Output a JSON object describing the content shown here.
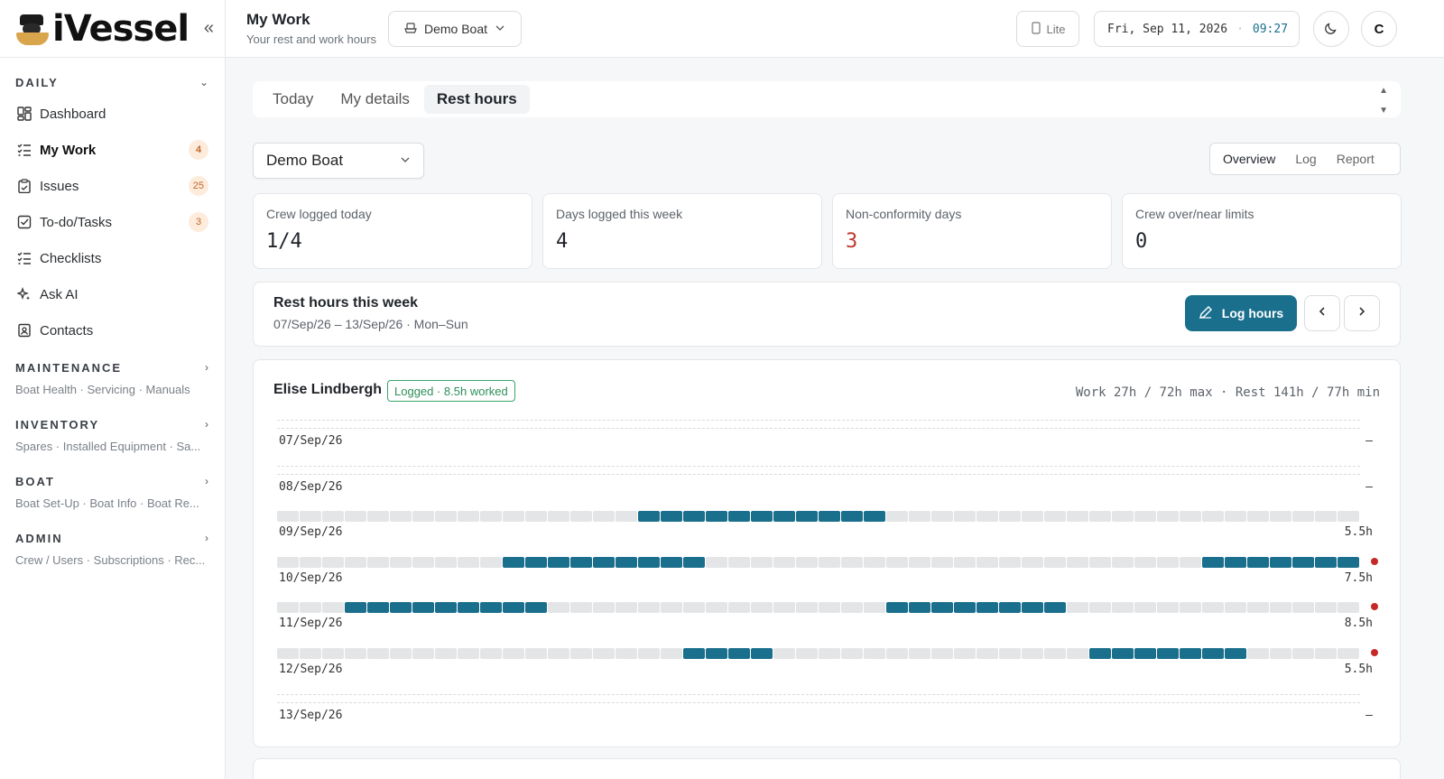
{
  "brand": {
    "name": "iVessel"
  },
  "sidebar": {
    "sections": [
      {
        "id": "daily",
        "title": "DAILY"
      },
      {
        "id": "maintenance",
        "title": "MAINTENANCE",
        "sub": "Boat Health · Servicing · Manuals"
      },
      {
        "id": "inventory",
        "title": "INVENTORY",
        "sub": "Spares · Installed Equipment · Sa..."
      },
      {
        "id": "boat",
        "title": "BOAT",
        "sub": "Boat Set-Up · Boat Info · Boat Re..."
      },
      {
        "id": "admin",
        "title": "ADMIN",
        "sub": "Crew / Users · Subscriptions · Rec..."
      }
    ],
    "items": [
      {
        "label": "Dashboard",
        "icon": "dashboard-icon"
      },
      {
        "label": "My Work",
        "icon": "list-check-icon",
        "badge": "4",
        "active": true
      },
      {
        "label": "Issues",
        "icon": "clipboard-icon",
        "badge": "25"
      },
      {
        "label": "To-do/Tasks",
        "icon": "checkbox-icon",
        "badge": "3"
      },
      {
        "label": "Checklists",
        "icon": "checklist-icon"
      },
      {
        "label": "Ask AI",
        "icon": "sparkle-icon"
      },
      {
        "label": "Contacts",
        "icon": "contacts-icon"
      }
    ]
  },
  "header": {
    "title": "My Work",
    "subtitle": "Your rest and work hours",
    "boat_selector": "Demo Boat",
    "lite_label": "Lite",
    "date": "Fri, Sep 11, 2026",
    "time": "09:27",
    "avatar_initial": "C"
  },
  "tabs": [
    {
      "label": "Today"
    },
    {
      "label": "My details"
    },
    {
      "label": "Rest hours",
      "active": true
    }
  ],
  "boat_dropdown": "Demo Boat",
  "view_toggle": [
    {
      "label": "Overview",
      "active": true
    },
    {
      "label": "Log"
    },
    {
      "label": "Report"
    }
  ],
  "stats": [
    {
      "label": "Crew logged today",
      "value": "1/4"
    },
    {
      "label": "Days logged this week",
      "value": "4"
    },
    {
      "label": "Non-conformity days",
      "value": "3",
      "alert": true
    },
    {
      "label": "Crew over/near limits",
      "value": "0"
    }
  ],
  "week_panel": {
    "title": "Rest hours this week",
    "range": "07/Sep/26 – 13/Sep/26 · Mon–Sun",
    "log_button": "Log hours"
  },
  "person": {
    "name": "Elise Lindbergh",
    "status": "Logged · 8.5h worked",
    "summary": "Work 27h / 72h max · Rest 141h / 77h min"
  },
  "colors": {
    "work": "#1a6f8d",
    "rest": "#e3e5e7",
    "alert": "#c62828",
    "logged": "#2e8f59"
  },
  "days": [
    {
      "date": "07/Sep/26",
      "hours": "–",
      "logged": false,
      "flag": false,
      "work_slots": []
    },
    {
      "date": "08/Sep/26",
      "hours": "–",
      "logged": false,
      "flag": false,
      "work_slots": []
    },
    {
      "date": "09/Sep/26",
      "hours": "5.5h",
      "logged": true,
      "flag": false,
      "work_slots": [
        [
          16,
          27
        ]
      ]
    },
    {
      "date": "10/Sep/26",
      "hours": "7.5h",
      "logged": true,
      "flag": true,
      "work_slots": [
        [
          10,
          19
        ],
        [
          41,
          48
        ]
      ]
    },
    {
      "date": "11/Sep/26",
      "hours": "8.5h",
      "logged": true,
      "flag": true,
      "work_slots": [
        [
          3,
          12
        ],
        [
          27,
          35
        ]
      ]
    },
    {
      "date": "12/Sep/26",
      "hours": "5.5h",
      "logged": true,
      "flag": true,
      "work_slots": [
        [
          18,
          22
        ],
        [
          36,
          43
        ]
      ]
    },
    {
      "date": "13/Sep/26",
      "hours": "–",
      "logged": false,
      "flag": false,
      "work_slots": []
    }
  ]
}
